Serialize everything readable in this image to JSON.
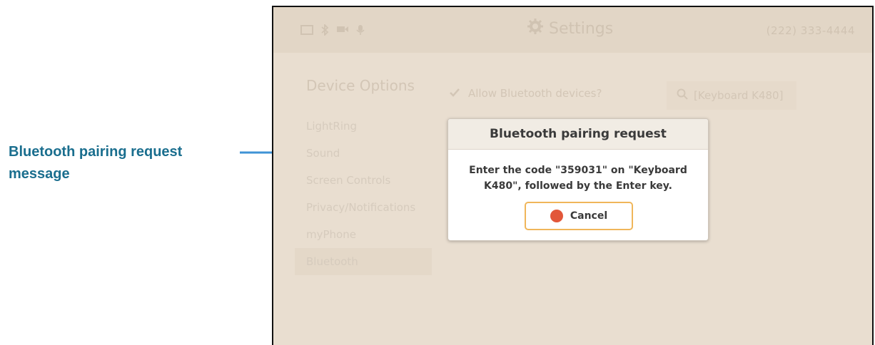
{
  "callout": {
    "text": "Bluetooth pairing request message",
    "color": "#1a6e8e",
    "arrow_color": "#3f93d6"
  },
  "topbar": {
    "title": "Settings",
    "phone_number": "(222) 333-4444",
    "icons": [
      "window-icon",
      "bluetooth-icon",
      "camera-icon",
      "microphone-icon",
      "gear-icon"
    ]
  },
  "sidebar": {
    "title": "Device Options",
    "items": [
      {
        "label": "LightRing"
      },
      {
        "label": "Sound"
      },
      {
        "label": "Screen Controls"
      },
      {
        "label": "Privacy/Notifications"
      },
      {
        "label": "myPhone"
      },
      {
        "label": "Bluetooth",
        "active": true
      }
    ]
  },
  "bluetooth": {
    "allow_label": "Allow Bluetooth devices?",
    "allow_checked": true,
    "search_text": "[Keyboard K480]"
  },
  "dialog": {
    "title": "Bluetooth pairing request",
    "message": "Enter the code \"359031\" on \"Keyboard K480\", followed by the Enter key.",
    "cancel_label": "Cancel",
    "accent_color": "#f0b65a",
    "cancel_dot_color": "#e2573a"
  }
}
